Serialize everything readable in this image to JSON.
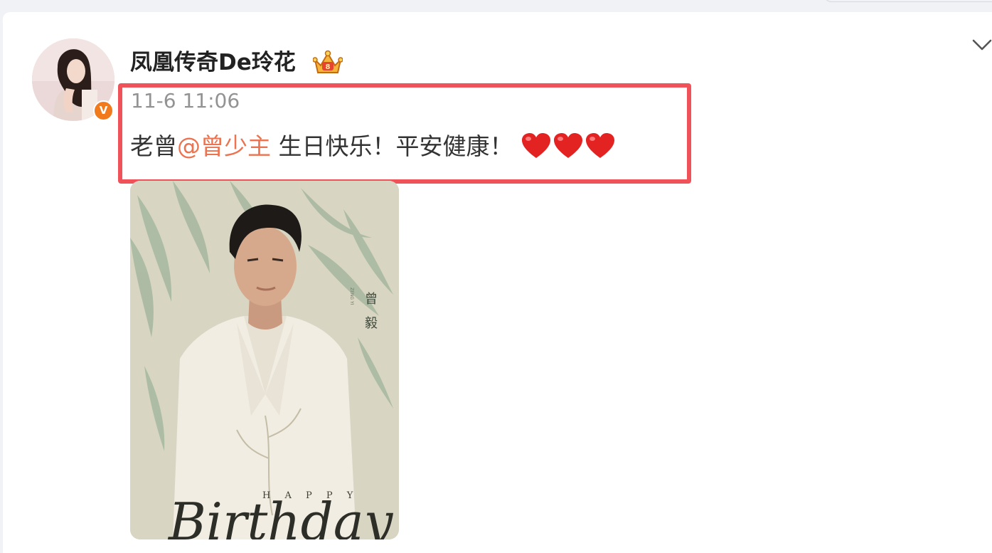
{
  "post": {
    "author": {
      "name": "凤凰传奇De玲花",
      "badge_icon": "crown-vip-icon",
      "verified_icon": "verified-v-icon",
      "verified_mark": "V"
    },
    "time": "11-6 11:06",
    "text": {
      "prefix": "老曾",
      "mention": "@曾少主",
      "suffix": " 生日快乐！平安健康！",
      "emoji": "heart-emoji ×3"
    },
    "image": {
      "name_line1": "曾",
      "name_line2": "毅",
      "small_caption": "ZENG YI",
      "happy": "H A P P Y",
      "birthday": "Birthday"
    },
    "more_icon": "chevron-down-icon"
  },
  "colors": {
    "highlight_border": "#f0525a",
    "mention": "#eb7350",
    "verified_badge": "#f07a1c",
    "timestamp": "#939393",
    "background": "#f1f2f5"
  }
}
